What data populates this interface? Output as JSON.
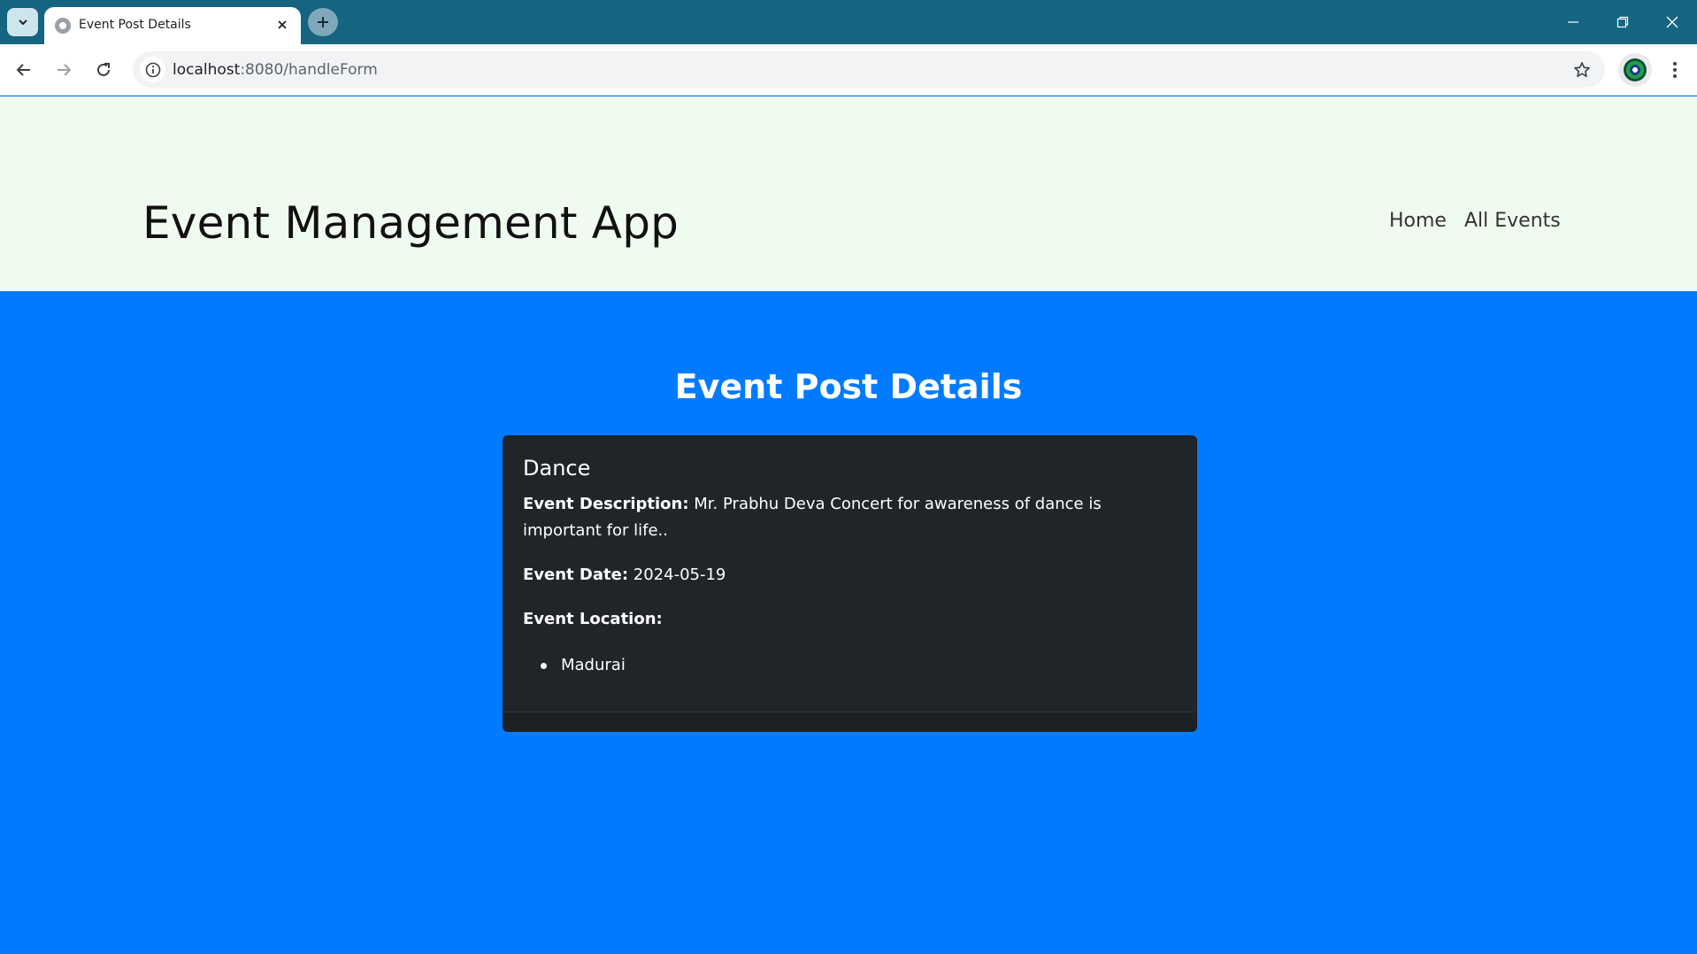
{
  "browser": {
    "tab_title": "Event Post Details",
    "url_host": "localhost",
    "url_path": ":8080/handleForm",
    "window_controls": {
      "minimize": "—",
      "restore": "❐",
      "close": "✕"
    }
  },
  "site": {
    "brand": "Event Management App",
    "nav": [
      "Home",
      "All Events"
    ]
  },
  "main": {
    "heading": "Event Post Details",
    "event": {
      "title": "Dance",
      "description_label": "Event Description:",
      "description": "Mr. Prabhu Deva Concert for awareness of dance is important for life..",
      "date_label": "Event Date:",
      "date": "2024-05-19",
      "location_label": "Event Location:",
      "locations": [
        "Madurai"
      ]
    }
  },
  "colors": {
    "tabbar": "#156480",
    "header_bg": "#f0fbef",
    "page_bg": "#007bff",
    "card_bg": "#212529"
  },
  "icons": [
    "chevron-down-icon",
    "globe-icon",
    "close-icon",
    "plus-icon",
    "back-arrow-icon",
    "forward-arrow-icon",
    "reload-icon",
    "info-icon",
    "star-icon",
    "profile-icon",
    "more-vert-icon"
  ]
}
